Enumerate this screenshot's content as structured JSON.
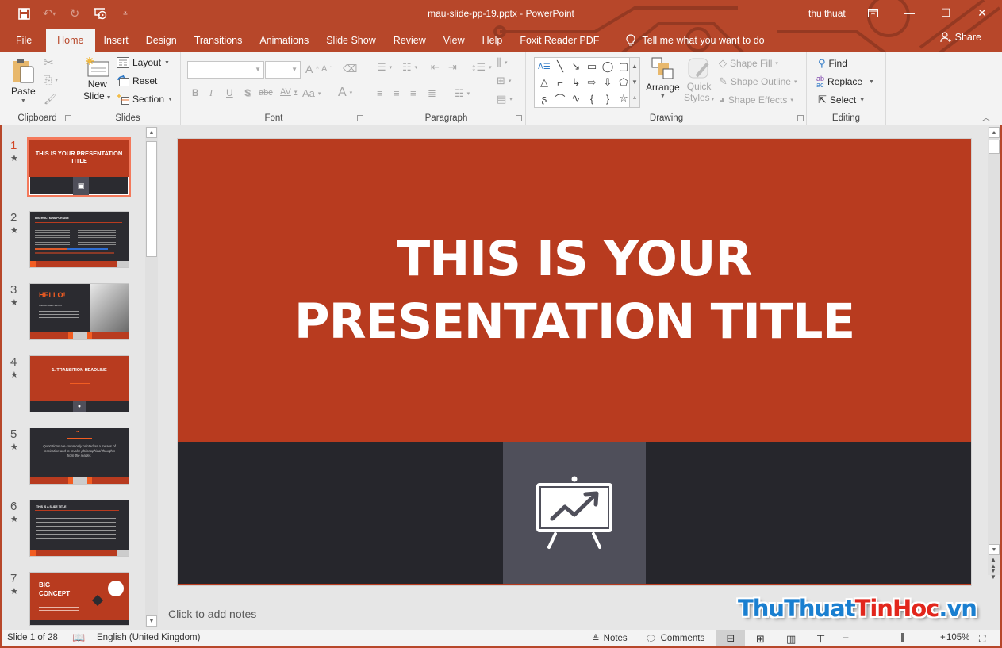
{
  "window": {
    "title": "mau-slide-pp-19.pptx  -  PowerPoint",
    "user": "thu thuat",
    "controls": {
      "ribbon_display": "⊡",
      "minimize": "—",
      "maximize": "☐",
      "close": "✕"
    }
  },
  "quick_access": {
    "save": "save-icon",
    "undo": "undo-icon",
    "redo": "redo-icon",
    "present": "start-from-beginning-icon",
    "customize": "customize-qat-icon"
  },
  "tabs": [
    {
      "label": "File"
    },
    {
      "label": "Home",
      "active": true
    },
    {
      "label": "Insert"
    },
    {
      "label": "Design"
    },
    {
      "label": "Transitions"
    },
    {
      "label": "Animations"
    },
    {
      "label": "Slide Show"
    },
    {
      "label": "Review"
    },
    {
      "label": "View"
    },
    {
      "label": "Help"
    },
    {
      "label": "Foxit Reader PDF"
    }
  ],
  "tell_me": "Tell me what you want to do",
  "share": "Share",
  "ribbon": {
    "clipboard": {
      "label": "Clipboard",
      "paste": "Paste"
    },
    "slides": {
      "label": "Slides",
      "new_slide_1": "New",
      "new_slide_2": "Slide",
      "layout": "Layout",
      "reset": "Reset",
      "section": "Section"
    },
    "font": {
      "label": "Font",
      "font_name": "",
      "font_size": "",
      "bold": "B",
      "italic": "I",
      "underline": "U",
      "shadow": "S",
      "strike": "abc",
      "spacing": "AV",
      "case": "Aa",
      "color": "A",
      "grow": "A",
      "shrink": "A"
    },
    "paragraph": {
      "label": "Paragraph"
    },
    "drawing": {
      "label": "Drawing",
      "arrange": "Arrange",
      "quick_styles_1": "Quick",
      "quick_styles_2": "Styles",
      "shape_fill": "Shape Fill",
      "shape_outline": "Shape Outline",
      "shape_effects": "Shape Effects"
    },
    "editing": {
      "label": "Editing",
      "find": "Find",
      "replace": "Replace",
      "select": "Select"
    }
  },
  "thumbnails": [
    {
      "num": "1",
      "title": "THIS IS YOUR PRESENTATION TITLE",
      "current": true
    },
    {
      "num": "2",
      "title": "INSTRUCTIONS FOR USE"
    },
    {
      "num": "3",
      "title": "HELLO!",
      "text": "I AM JAYDEN SMITH"
    },
    {
      "num": "4",
      "title": "1. TRANSITION HEADLINE"
    },
    {
      "num": "5",
      "title": "Quotations are commonly printed as a means of inspiration and to invoke philosophical thoughts from the reader."
    },
    {
      "num": "6",
      "title": "THIS IS A SLIDE TITLE"
    },
    {
      "num": "7",
      "title": "BIG CONCEPT"
    }
  ],
  "slide": {
    "title_line1": "THIS IS YOUR",
    "title_line2": "PRESENTATION TITLE",
    "icon": "presentation-chart-icon"
  },
  "notes_placeholder": "Click to add notes",
  "status": {
    "slide_of": "Slide 1 of 28",
    "language": "English (United Kingdom)",
    "notes": "Notes",
    "comments": "Comments",
    "zoom": "105%",
    "zoom_fraction": 0.6
  },
  "watermark": {
    "part1": "ThuThuat",
    "part2": "TinHoc",
    "part3": ".vn",
    "color1": "#1a7fd0",
    "color2": "#e2261c"
  },
  "colors": {
    "accent": "#b7472a",
    "slide_red": "#b83b1f",
    "slide_dark": "#26262c"
  }
}
